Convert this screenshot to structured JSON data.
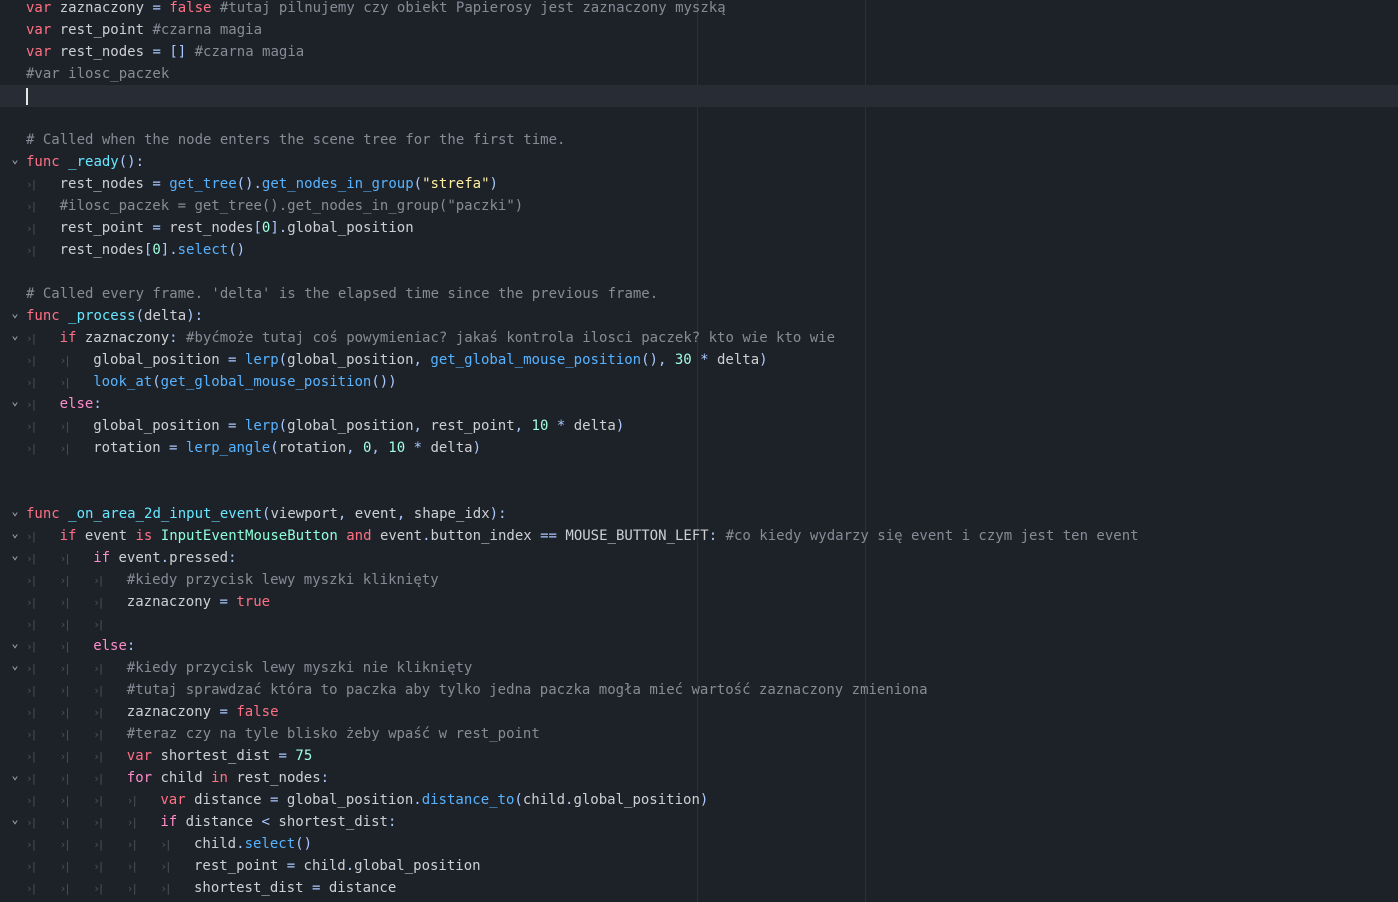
{
  "editor": {
    "lines": [
      {
        "fold": false,
        "indent": 0,
        "tokens": [
          {
            "c": "kw",
            "t": "var"
          },
          {
            "c": "tx",
            "t": " zaznaczony "
          },
          {
            "c": "sy",
            "t": "="
          },
          {
            "c": "tx",
            "t": " "
          },
          {
            "c": "kw",
            "t": "false"
          },
          {
            "c": "tx",
            "t": " "
          },
          {
            "c": "cm",
            "t": "#tutaj pilnujemy czy obiekt Papierosy jest zaznaczony myszką"
          }
        ]
      },
      {
        "fold": false,
        "indent": 0,
        "tokens": [
          {
            "c": "kw",
            "t": "var"
          },
          {
            "c": "tx",
            "t": " rest_point "
          },
          {
            "c": "cm",
            "t": "#czarna magia"
          }
        ]
      },
      {
        "fold": false,
        "indent": 0,
        "tokens": [
          {
            "c": "kw",
            "t": "var"
          },
          {
            "c": "tx",
            "t": " rest_nodes "
          },
          {
            "c": "sy",
            "t": "="
          },
          {
            "c": "tx",
            "t": " "
          },
          {
            "c": "sy",
            "t": "[]"
          },
          {
            "c": "tx",
            "t": " "
          },
          {
            "c": "cm",
            "t": "#czarna magia"
          }
        ]
      },
      {
        "fold": false,
        "indent": 0,
        "tokens": [
          {
            "c": "cm",
            "t": "#var ilosc_paczek"
          }
        ]
      },
      {
        "fold": false,
        "indent": 0,
        "current": true,
        "tokens": []
      },
      {
        "fold": false,
        "indent": 0,
        "tokens": []
      },
      {
        "fold": false,
        "indent": 0,
        "tokens": [
          {
            "c": "cm",
            "t": "# Called when the node enters the scene tree for the first time."
          }
        ]
      },
      {
        "fold": true,
        "indent": 0,
        "tokens": [
          {
            "c": "kw",
            "t": "func"
          },
          {
            "c": "tx",
            "t": " "
          },
          {
            "c": "fd",
            "t": "_ready"
          },
          {
            "c": "sy",
            "t": "():"
          }
        ]
      },
      {
        "fold": false,
        "indent": 1,
        "tokens": [
          {
            "c": "tx",
            "t": "rest_nodes "
          },
          {
            "c": "sy",
            "t": "="
          },
          {
            "c": "tx",
            "t": " "
          },
          {
            "c": "fn",
            "t": "get_tree"
          },
          {
            "c": "sy",
            "t": "()."
          },
          {
            "c": "fn",
            "t": "get_nodes_in_group"
          },
          {
            "c": "sy",
            "t": "("
          },
          {
            "c": "st",
            "t": "\"strefa\""
          },
          {
            "c": "sy",
            "t": ")"
          }
        ]
      },
      {
        "fold": false,
        "indent": 1,
        "tokens": [
          {
            "c": "cm",
            "t": "#ilosc_paczek = get_tree().get_nodes_in_group(\"paczki\")"
          }
        ]
      },
      {
        "fold": false,
        "indent": 1,
        "tokens": [
          {
            "c": "tx",
            "t": "rest_point "
          },
          {
            "c": "sy",
            "t": "="
          },
          {
            "c": "tx",
            "t": " rest_nodes"
          },
          {
            "c": "sy",
            "t": "["
          },
          {
            "c": "nm",
            "t": "0"
          },
          {
            "c": "sy",
            "t": "]."
          },
          {
            "c": "tx",
            "t": "global_position"
          }
        ]
      },
      {
        "fold": false,
        "indent": 1,
        "tokens": [
          {
            "c": "tx",
            "t": "rest_nodes"
          },
          {
            "c": "sy",
            "t": "["
          },
          {
            "c": "nm",
            "t": "0"
          },
          {
            "c": "sy",
            "t": "]."
          },
          {
            "c": "fn",
            "t": "select"
          },
          {
            "c": "sy",
            "t": "()"
          }
        ]
      },
      {
        "fold": false,
        "indent": 0,
        "tokens": []
      },
      {
        "fold": false,
        "indent": 0,
        "tokens": [
          {
            "c": "cm",
            "t": "# Called every frame. 'delta' is the elapsed time since the previous frame."
          }
        ]
      },
      {
        "fold": true,
        "indent": 0,
        "tokens": [
          {
            "c": "kw",
            "t": "func"
          },
          {
            "c": "tx",
            "t": " "
          },
          {
            "c": "fd",
            "t": "_process"
          },
          {
            "c": "sy",
            "t": "("
          },
          {
            "c": "tx",
            "t": "delta"
          },
          {
            "c": "sy",
            "t": "):"
          }
        ]
      },
      {
        "fold": true,
        "indent": 1,
        "tokens": [
          {
            "c": "kw",
            "t": "if"
          },
          {
            "c": "tx",
            "t": " zaznaczony"
          },
          {
            "c": "sy",
            "t": ":"
          },
          {
            "c": "tx",
            "t": " "
          },
          {
            "c": "cm",
            "t": "#byćmoże tutaj coś powymieniac? jakaś kontrola ilosci paczek? kto wie kto wie"
          }
        ]
      },
      {
        "fold": false,
        "indent": 2,
        "tokens": [
          {
            "c": "tx",
            "t": "global_position "
          },
          {
            "c": "sy",
            "t": "="
          },
          {
            "c": "tx",
            "t": " "
          },
          {
            "c": "fn",
            "t": "lerp"
          },
          {
            "c": "sy",
            "t": "("
          },
          {
            "c": "tx",
            "t": "global_position"
          },
          {
            "c": "sy",
            "t": ","
          },
          {
            "c": "tx",
            "t": " "
          },
          {
            "c": "fn",
            "t": "get_global_mouse_position"
          },
          {
            "c": "sy",
            "t": "(),"
          },
          {
            "c": "tx",
            "t": " "
          },
          {
            "c": "nm",
            "t": "30"
          },
          {
            "c": "tx",
            "t": " "
          },
          {
            "c": "sy",
            "t": "*"
          },
          {
            "c": "tx",
            "t": " delta"
          },
          {
            "c": "sy",
            "t": ")"
          }
        ]
      },
      {
        "fold": false,
        "indent": 2,
        "tokens": [
          {
            "c": "fn",
            "t": "look_at"
          },
          {
            "c": "sy",
            "t": "("
          },
          {
            "c": "fn",
            "t": "get_global_mouse_position"
          },
          {
            "c": "sy",
            "t": "())"
          }
        ]
      },
      {
        "fold": true,
        "indent": 1,
        "tokens": [
          {
            "c": "ct",
            "t": "else"
          },
          {
            "c": "sy",
            "t": ":"
          }
        ]
      },
      {
        "fold": false,
        "indent": 2,
        "tokens": [
          {
            "c": "tx",
            "t": "global_position "
          },
          {
            "c": "sy",
            "t": "="
          },
          {
            "c": "tx",
            "t": " "
          },
          {
            "c": "fn",
            "t": "lerp"
          },
          {
            "c": "sy",
            "t": "("
          },
          {
            "c": "tx",
            "t": "global_position"
          },
          {
            "c": "sy",
            "t": ","
          },
          {
            "c": "tx",
            "t": " rest_point"
          },
          {
            "c": "sy",
            "t": ","
          },
          {
            "c": "tx",
            "t": " "
          },
          {
            "c": "nm",
            "t": "10"
          },
          {
            "c": "tx",
            "t": " "
          },
          {
            "c": "sy",
            "t": "*"
          },
          {
            "c": "tx",
            "t": " delta"
          },
          {
            "c": "sy",
            "t": ")"
          }
        ]
      },
      {
        "fold": false,
        "indent": 2,
        "tokens": [
          {
            "c": "tx",
            "t": "rotation "
          },
          {
            "c": "sy",
            "t": "="
          },
          {
            "c": "tx",
            "t": " "
          },
          {
            "c": "fn",
            "t": "lerp_angle"
          },
          {
            "c": "sy",
            "t": "("
          },
          {
            "c": "tx",
            "t": "rotation"
          },
          {
            "c": "sy",
            "t": ","
          },
          {
            "c": "tx",
            "t": " "
          },
          {
            "c": "nm",
            "t": "0"
          },
          {
            "c": "sy",
            "t": ","
          },
          {
            "c": "tx",
            "t": " "
          },
          {
            "c": "nm",
            "t": "10"
          },
          {
            "c": "tx",
            "t": " "
          },
          {
            "c": "sy",
            "t": "*"
          },
          {
            "c": "tx",
            "t": " delta"
          },
          {
            "c": "sy",
            "t": ")"
          }
        ]
      },
      {
        "fold": false,
        "indent": 0,
        "tokens": []
      },
      {
        "fold": false,
        "indent": 0,
        "tokens": []
      },
      {
        "fold": true,
        "indent": 0,
        "tokens": [
          {
            "c": "kw",
            "t": "func"
          },
          {
            "c": "tx",
            "t": " "
          },
          {
            "c": "fd",
            "t": "_on_area_2d_input_event"
          },
          {
            "c": "sy",
            "t": "("
          },
          {
            "c": "tx",
            "t": "viewport"
          },
          {
            "c": "sy",
            "t": ","
          },
          {
            "c": "tx",
            "t": " event"
          },
          {
            "c": "sy",
            "t": ","
          },
          {
            "c": "tx",
            "t": " shape_idx"
          },
          {
            "c": "sy",
            "t": "):"
          }
        ]
      },
      {
        "fold": true,
        "indent": 1,
        "tokens": [
          {
            "c": "kw",
            "t": "if"
          },
          {
            "c": "tx",
            "t": " event "
          },
          {
            "c": "kw",
            "t": "is"
          },
          {
            "c": "tx",
            "t": " "
          },
          {
            "c": "ty",
            "t": "InputEventMouseButton"
          },
          {
            "c": "tx",
            "t": " "
          },
          {
            "c": "kw",
            "t": "and"
          },
          {
            "c": "tx",
            "t": " event"
          },
          {
            "c": "sy",
            "t": "."
          },
          {
            "c": "tx",
            "t": "button_index "
          },
          {
            "c": "sy",
            "t": "=="
          },
          {
            "c": "tx",
            "t": " MOUSE_BUTTON_LEFT"
          },
          {
            "c": "sy",
            "t": ":"
          },
          {
            "c": "tx",
            "t": " "
          },
          {
            "c": "cm",
            "t": "#co kiedy wydarzy się event i czym jest ten event"
          }
        ]
      },
      {
        "fold": true,
        "indent": 2,
        "tokens": [
          {
            "c": "ct",
            "t": "if"
          },
          {
            "c": "tx",
            "t": " event"
          },
          {
            "c": "sy",
            "t": "."
          },
          {
            "c": "tx",
            "t": "pressed"
          },
          {
            "c": "sy",
            "t": ":"
          }
        ]
      },
      {
        "fold": false,
        "indent": 3,
        "tokens": [
          {
            "c": "cm",
            "t": "#kiedy przycisk lewy myszki kliknięty"
          }
        ]
      },
      {
        "fold": false,
        "indent": 3,
        "tokens": [
          {
            "c": "tx",
            "t": "zaznaczony "
          },
          {
            "c": "sy",
            "t": "="
          },
          {
            "c": "tx",
            "t": " "
          },
          {
            "c": "kw",
            "t": "true"
          }
        ]
      },
      {
        "fold": false,
        "indent": 3,
        "tokens": []
      },
      {
        "fold": true,
        "indent": 2,
        "tokens": [
          {
            "c": "ct",
            "t": "else"
          },
          {
            "c": "sy",
            "t": ":"
          }
        ]
      },
      {
        "fold": true,
        "indent": 3,
        "tokens": [
          {
            "c": "cm",
            "t": "#kiedy przycisk lewy myszki nie kliknięty"
          }
        ]
      },
      {
        "fold": false,
        "indent": 3,
        "tokens": [
          {
            "c": "cm",
            "t": "#tutaj sprawdzać która to paczka aby tylko jedna paczka mogła mieć wartość zaznaczony zmieniona"
          }
        ]
      },
      {
        "fold": false,
        "indent": 3,
        "tokens": [
          {
            "c": "tx",
            "t": "zaznaczony "
          },
          {
            "c": "sy",
            "t": "="
          },
          {
            "c": "tx",
            "t": " "
          },
          {
            "c": "kw",
            "t": "false"
          }
        ]
      },
      {
        "fold": false,
        "indent": 3,
        "tokens": [
          {
            "c": "cm",
            "t": "#teraz czy na tyle blisko żeby wpaść w rest_point"
          }
        ]
      },
      {
        "fold": false,
        "indent": 3,
        "tokens": [
          {
            "c": "kw",
            "t": "var"
          },
          {
            "c": "tx",
            "t": " shortest_dist "
          },
          {
            "c": "sy",
            "t": "="
          },
          {
            "c": "tx",
            "t": " "
          },
          {
            "c": "nm",
            "t": "75"
          }
        ]
      },
      {
        "fold": true,
        "indent": 3,
        "tokens": [
          {
            "c": "ct",
            "t": "for"
          },
          {
            "c": "tx",
            "t": " child "
          },
          {
            "c": "kw",
            "t": "in"
          },
          {
            "c": "tx",
            "t": " rest_nodes"
          },
          {
            "c": "sy",
            "t": ":"
          }
        ]
      },
      {
        "fold": false,
        "indent": 4,
        "tokens": [
          {
            "c": "kw",
            "t": "var"
          },
          {
            "c": "tx",
            "t": " distance "
          },
          {
            "c": "sy",
            "t": "="
          },
          {
            "c": "tx",
            "t": " global_position"
          },
          {
            "c": "sy",
            "t": "."
          },
          {
            "c": "fn",
            "t": "distance_to"
          },
          {
            "c": "sy",
            "t": "("
          },
          {
            "c": "tx",
            "t": "child"
          },
          {
            "c": "sy",
            "t": "."
          },
          {
            "c": "tx",
            "t": "global_position"
          },
          {
            "c": "sy",
            "t": ")"
          }
        ]
      },
      {
        "fold": true,
        "indent": 4,
        "tokens": [
          {
            "c": "ct",
            "t": "if"
          },
          {
            "c": "tx",
            "t": " distance "
          },
          {
            "c": "sy",
            "t": "<"
          },
          {
            "c": "tx",
            "t": " shortest_dist"
          },
          {
            "c": "sy",
            "t": ":"
          }
        ]
      },
      {
        "fold": false,
        "indent": 5,
        "tokens": [
          {
            "c": "tx",
            "t": "child"
          },
          {
            "c": "sy",
            "t": "."
          },
          {
            "c": "fn",
            "t": "select"
          },
          {
            "c": "sy",
            "t": "()"
          }
        ]
      },
      {
        "fold": false,
        "indent": 5,
        "tokens": [
          {
            "c": "tx",
            "t": "rest_point "
          },
          {
            "c": "sy",
            "t": "="
          },
          {
            "c": "tx",
            "t": " child"
          },
          {
            "c": "sy",
            "t": "."
          },
          {
            "c": "tx",
            "t": "global_position"
          }
        ]
      },
      {
        "fold": false,
        "indent": 5,
        "tokens": [
          {
            "c": "tx",
            "t": "shortest_dist "
          },
          {
            "c": "sy",
            "t": "="
          },
          {
            "c": "tx",
            "t": " distance"
          }
        ]
      }
    ]
  }
}
